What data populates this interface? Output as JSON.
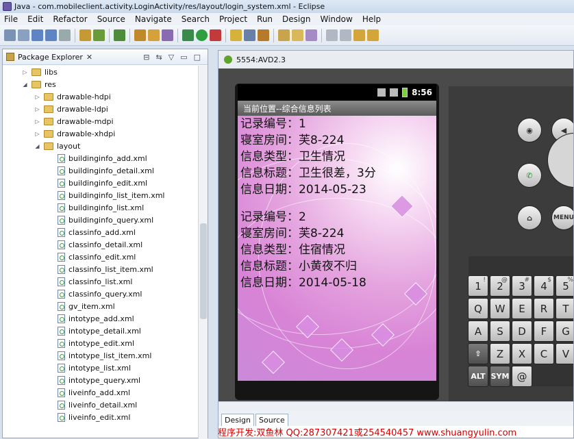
{
  "window": {
    "title": "Java - com.mobileclient.activity.LoginActivity/res/layout/login_system.xml - Eclipse"
  },
  "menu": [
    "File",
    "Edit",
    "Refactor",
    "Source",
    "Navigate",
    "Search",
    "Project",
    "Run",
    "Design",
    "Window",
    "Help"
  ],
  "package_explorer": {
    "title": "Package Explorer",
    "folders": [
      "libs",
      "res",
      "drawable-hdpi",
      "drawable-ldpi",
      "drawable-mdpi",
      "drawable-xhdpi",
      "layout"
    ],
    "files": [
      "buildinginfo_add.xml",
      "buildinginfo_detail.xml",
      "buildinginfo_edit.xml",
      "buildinginfo_list_item.xml",
      "buildinginfo_list.xml",
      "buildinginfo_query.xml",
      "classinfo_add.xml",
      "classinfo_detail.xml",
      "classinfo_edit.xml",
      "classinfo_list_item.xml",
      "classinfo_list.xml",
      "classinfo_query.xml",
      "gv_item.xml",
      "intotype_add.xml",
      "intotype_detail.xml",
      "intotype_edit.xml",
      "intotype_list_item.xml",
      "intotype_list.xml",
      "intotype_query.xml",
      "liveinfo_add.xml",
      "liveinfo_detail.xml",
      "liveinfo_edit.xml"
    ]
  },
  "emulator": {
    "title": "5554:AVD2.3",
    "time": "8:56",
    "app_title": "当前位置--综合信息列表",
    "records": [
      {
        "id": "记录编号：1",
        "room": "寝室房间：芙8-224",
        "type": "信息类型：卫生情况",
        "subject": "信息标题：卫生很差，3分",
        "date": "信息日期：2014-05-23"
      },
      {
        "id": "记录编号：2",
        "room": "寝室房间：芙8-224",
        "type": "信息类型：住宿情况",
        "subject": "信息标题：小黄夜不归",
        "date": "信息日期：2014-05-18"
      }
    ],
    "menu_button": "MENU",
    "keys_row1": [
      [
        "1",
        "!"
      ],
      [
        "2",
        "@"
      ],
      [
        "3",
        "#"
      ],
      [
        "4",
        "$"
      ],
      [
        "5",
        "%"
      ]
    ],
    "keys_row2": [
      "Q",
      "W",
      "E",
      "R",
      "T"
    ],
    "keys_row3": [
      "A",
      "S",
      "D",
      "F",
      "G"
    ],
    "keys_row4": [
      "⇧",
      "Z",
      "X",
      "C",
      "V"
    ],
    "keys_row5": [
      "ALT",
      "SYM",
      "@"
    ]
  },
  "editor_tabs": [
    "Design",
    "Source"
  ],
  "footer": "程序开发:双鱼林 QQ:287307421或254540457 www.shuangyulin.com"
}
